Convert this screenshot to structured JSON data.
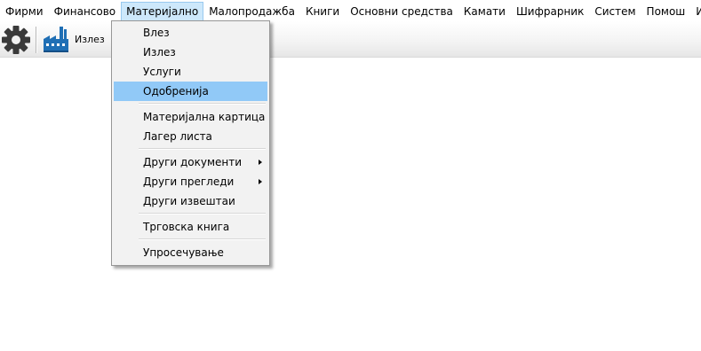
{
  "menubar": {
    "items": [
      {
        "label": "Фирми"
      },
      {
        "label": "Финансово"
      },
      {
        "label": "Материјално"
      },
      {
        "label": "Малопродажба"
      },
      {
        "label": "Книги"
      },
      {
        "label": "Основни средства"
      },
      {
        "label": "Камати"
      },
      {
        "label": "Шифрарник"
      },
      {
        "label": "Систем"
      },
      {
        "label": "Помош"
      },
      {
        "label": "Излез"
      }
    ]
  },
  "toolbar": {
    "settings_icon": "gear-icon",
    "exit_icon": "factory-icon",
    "exit_label": "Излез"
  },
  "dropdown": {
    "items": [
      {
        "label": "Влез"
      },
      {
        "label": "Излез"
      },
      {
        "label": "Услуги"
      },
      {
        "label": "Одобренија",
        "highlighted": true
      },
      {
        "label": "Материјална картица"
      },
      {
        "label": "Лагер листа"
      },
      {
        "label": "Други документи",
        "submenu": true
      },
      {
        "label": "Други прегледи",
        "submenu": true
      },
      {
        "label": "Други извештаи"
      },
      {
        "label": "Трговска книга"
      },
      {
        "label": "Упросечување"
      }
    ]
  },
  "colors": {
    "highlight": "#91c9f7",
    "menu_open": "#cde8fb",
    "factory": "#1f6fb5"
  }
}
